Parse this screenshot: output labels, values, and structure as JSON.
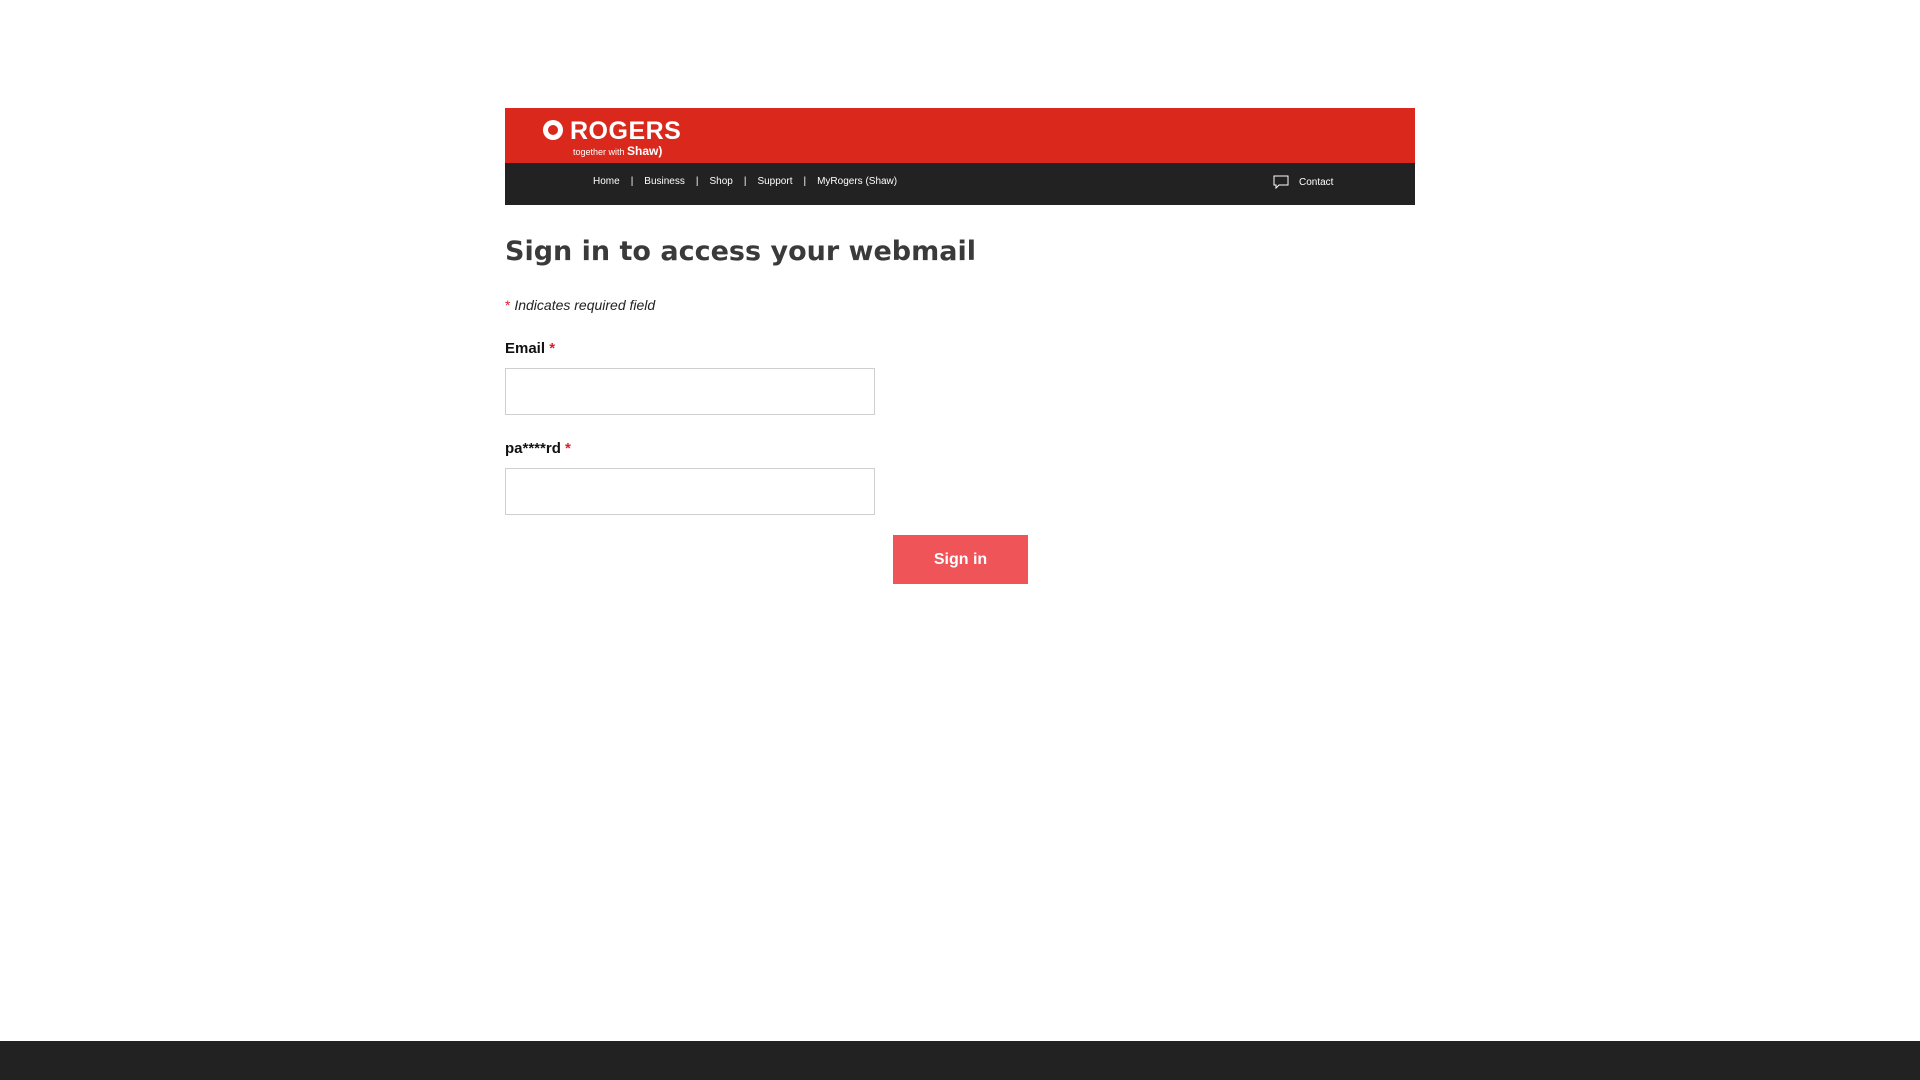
{
  "header": {
    "logo": {
      "word": "ROGERS",
      "tagline": "together with",
      "partner": "Shaw"
    },
    "nav": [
      {
        "label": "Home"
      },
      {
        "label": "Business"
      },
      {
        "label": "Shop"
      },
      {
        "label": "Support"
      },
      {
        "label": "MyRogers (Shaw)"
      }
    ],
    "separator": "|",
    "contact": {
      "label": "Contact",
      "icon": "chat-bubble-icon"
    }
  },
  "form": {
    "title": "Sign in to access your webmail",
    "required_marker": "*",
    "required_note": "Indicates required field",
    "email": {
      "label": "Email",
      "value": "",
      "placeholder": ""
    },
    "password": {
      "label": "pa****rd",
      "value": "",
      "placeholder": ""
    },
    "submit_label": "Sign in"
  },
  "colors": {
    "brand_red": "#da291c",
    "nav_dark": "#222222",
    "button": "#ee5458",
    "required_star": "#e21b2c"
  }
}
